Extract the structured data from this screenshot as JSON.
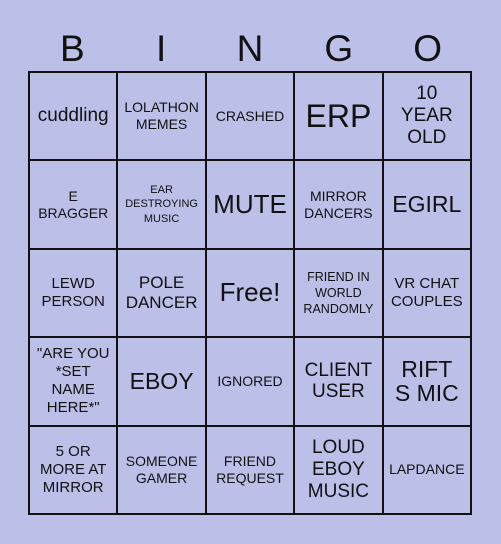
{
  "card": {
    "background_color": "#bcbfe8",
    "line_color": "#111111",
    "header": [
      "B",
      "I",
      "N",
      "G",
      "O"
    ],
    "cells": [
      {
        "text": "cuddling",
        "size": "s-m"
      },
      {
        "text": "LOLATHON\nMEMES",
        "size": "s-xs"
      },
      {
        "text": "CRASHED",
        "size": "s-xs"
      },
      {
        "text": "ERP",
        "size": "s-xl"
      },
      {
        "text": "10\nYEAR\nOLD",
        "size": "s-m"
      },
      {
        "text": "E\nBRAGGER",
        "size": "s-xs"
      },
      {
        "text": "EAR\nDESTROYING\nMUSIC",
        "size": "s-tiny"
      },
      {
        "text": "MUTE",
        "size": "s-l"
      },
      {
        "text": "MIRROR\nDANCERS",
        "size": "s-xs"
      },
      {
        "text": "EGIRL",
        "size": "s-lm"
      },
      {
        "text": "LEWD\nPERSON",
        "size": "s-s"
      },
      {
        "text": "POLE\nDANCER",
        "size": "s-ms"
      },
      {
        "text": "Free!",
        "size": "s-l"
      },
      {
        "text": "FRIEND IN\nWORLD\nRANDOMLY",
        "size": "s-xxs"
      },
      {
        "text": "VR CHAT\nCOUPLES",
        "size": "s-s"
      },
      {
        "text": "\"ARE YOU\n*SET\nNAME\nHERE*\"",
        "size": "s-s"
      },
      {
        "text": "EBOY",
        "size": "s-lm"
      },
      {
        "text": "IGNORED",
        "size": "s-xs"
      },
      {
        "text": "CLIENT\nUSER",
        "size": "s-m"
      },
      {
        "text": "RIFT\nS MIC",
        "size": "s-lm"
      },
      {
        "text": "5 OR\nMORE AT\nMIRROR",
        "size": "s-s"
      },
      {
        "text": "SOMEONE\nGAMER",
        "size": "s-xs"
      },
      {
        "text": "FRIEND\nREQUEST",
        "size": "s-xs"
      },
      {
        "text": "LOUD\nEBOY\nMUSIC",
        "size": "s-m"
      },
      {
        "text": "LAPDANCE",
        "size": "s-xs"
      }
    ]
  }
}
